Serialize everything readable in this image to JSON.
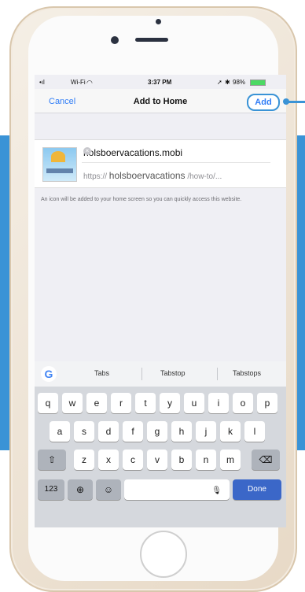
{
  "status_bar": {
    "carrier": "•ıl",
    "wifi": "Wi-Fi",
    "time": "3:37 PM",
    "battery": "98%"
  },
  "nav": {
    "cancel": "Cancel",
    "title": "Add to Home",
    "add": "Add"
  },
  "card": {
    "title_value": "holsboervacations.mobi",
    "url_prefix": "https://",
    "url_host": "holsboervacations",
    "url_path": "/how-to/..."
  },
  "hint": "An icon will be added to your home screen so you can quickly access this website.",
  "keyboard": {
    "suggestions": [
      "Tabs",
      "Tabstop",
      "Tabstops"
    ],
    "row1": [
      "q",
      "w",
      "e",
      "r",
      "t",
      "y",
      "u",
      "i",
      "o",
      "p"
    ],
    "row2": [
      "a",
      "s",
      "d",
      "f",
      "g",
      "h",
      "j",
      "k",
      "l"
    ],
    "row3": [
      "z",
      "x",
      "c",
      "v",
      "b",
      "n",
      "m"
    ],
    "numbers": "123",
    "done": "Done"
  },
  "accent": "#3a93d6",
  "link_color": "#2f7cf6",
  "done_color": "#3b67c8"
}
